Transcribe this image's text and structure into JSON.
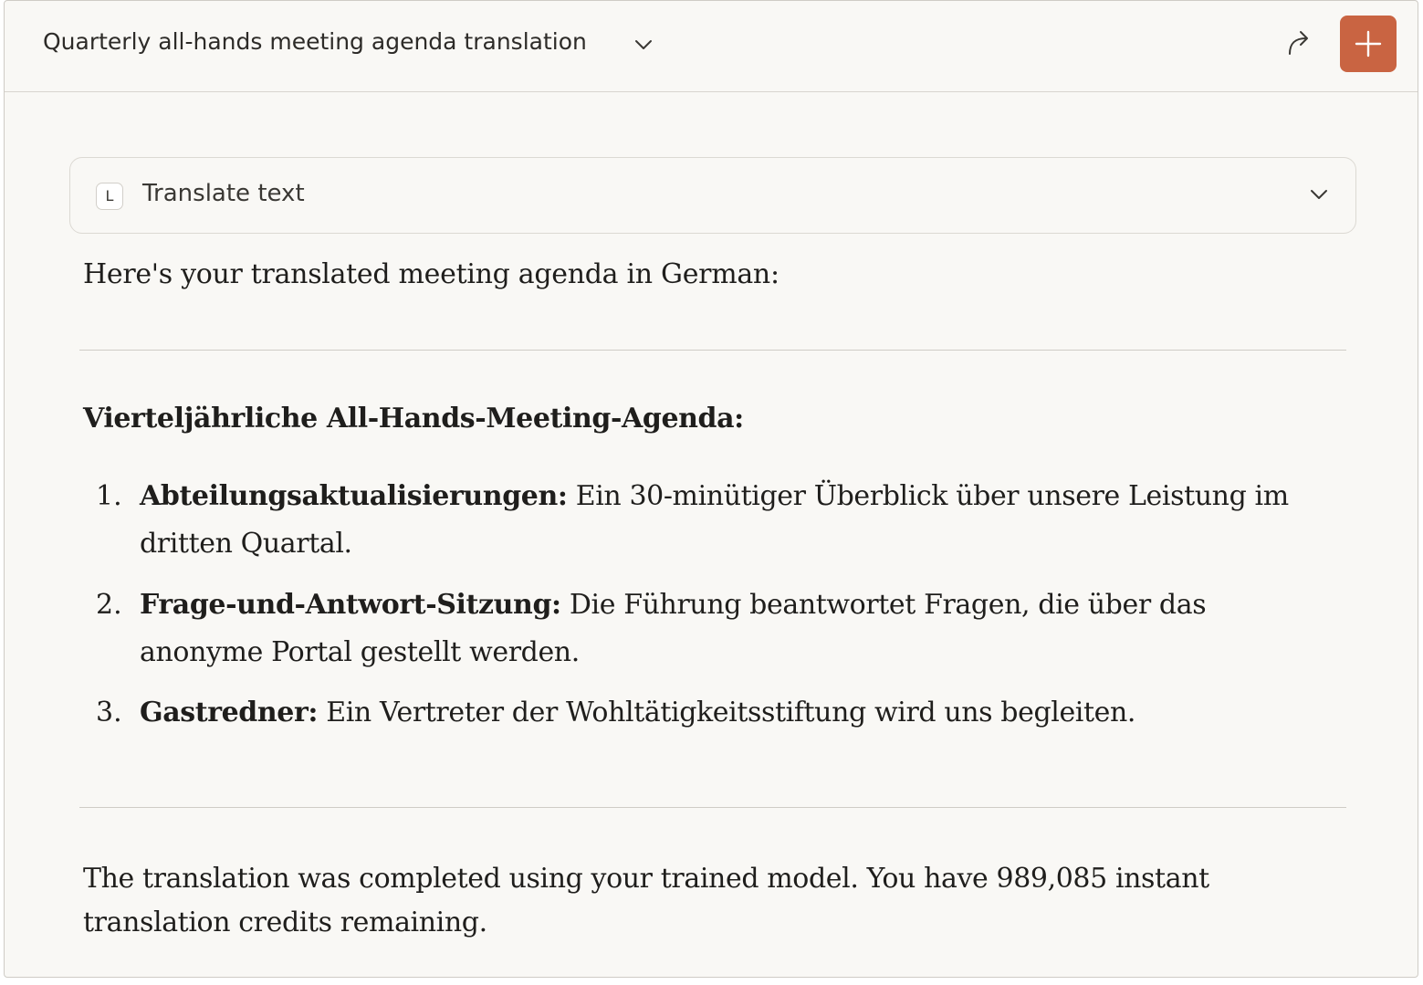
{
  "header": {
    "title": "Quarterly all-hands meeting agenda translation",
    "title_chevron_icon": "chevron-down-icon",
    "share_icon": "share-arrow-icon",
    "new_chat_icon": "plus-icon",
    "accent_color": "#c96442"
  },
  "tool_call": {
    "badge": "L",
    "label": "Translate text",
    "chevron_icon": "chevron-down-icon"
  },
  "message": {
    "intro": "Here's your translated meeting agenda in German:",
    "heading": "Vierteljährliche All-Hands-Meeting-Agenda:",
    "items": [
      {
        "number": "1.",
        "title": "Abteilungsaktualisierungen:",
        "text": " Ein 30-minütiger Überblick über unsere Leistung im dritten Quartal."
      },
      {
        "number": "2.",
        "title": "Frage-und-Antwort-Sitzung:",
        "text": " Die Führung beantwortet Fragen, die über das anonyme Portal gestellt werden."
      },
      {
        "number": "3.",
        "title": "Gastredner:",
        "text": " Ein Vertreter der Wohltätigkeitsstiftung wird uns begleiten."
      }
    ],
    "outro": "The translation was completed using your trained model. You have 989,085 instant translation credits remaining."
  }
}
